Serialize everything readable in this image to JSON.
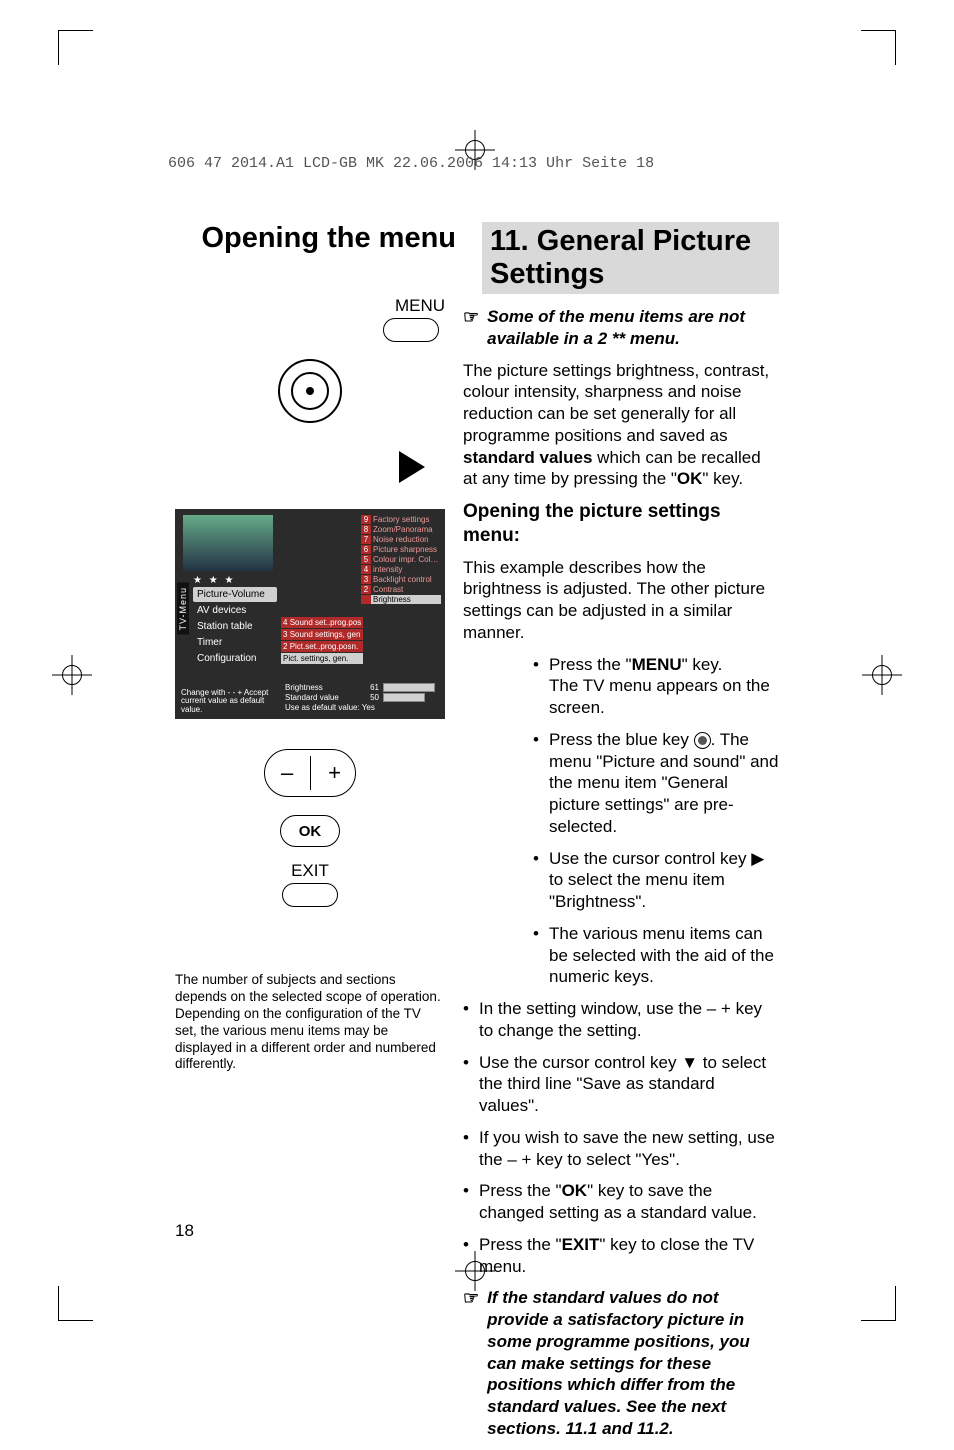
{
  "header_line": "606 47 2014.A1 LCD-GB MK  22.06.2006  14:13 Uhr  Seite 18",
  "title_left": "Opening the menu",
  "title_right": "11. General Picture Settings",
  "remote": {
    "menu_label": "MENU",
    "ok_label": "OK",
    "exit_label": "EXIT"
  },
  "osd": {
    "tab_vertical": "TV-Menu",
    "stars": "★  ★  ★",
    "side": [
      "Picture-Volume",
      "AV devices",
      "Station table",
      "Timer",
      "Configuration"
    ],
    "side_selected": 0,
    "mid": [
      "Sound set..prog.pos",
      "Sound settings, gen",
      "Pict.set..prog.posn.",
      "Pict. settings, gen."
    ],
    "mid_nums": [
      "4",
      "3",
      "2",
      ""
    ],
    "mid_selected": 3,
    "right": [
      {
        "n": "9",
        "t": "Factory settings"
      },
      {
        "n": "8",
        "t": "Zoom/Panorama"
      },
      {
        "n": "7",
        "t": "Noise reduction"
      },
      {
        "n": "6",
        "t": "Picture sharpness"
      },
      {
        "n": "5",
        "t": "Colour impr. Colour"
      },
      {
        "n": "4",
        "t": "intensity"
      },
      {
        "n": "3",
        "t": "Backlight control"
      },
      {
        "n": "2",
        "t": "Contrast"
      },
      {
        "n": "",
        "t": "Brightness"
      }
    ],
    "right_selected": 8,
    "hint": "Change with - - +\nAccept current\nvalue as default\nvalue.",
    "bars": {
      "brightness_label": "Brightness",
      "brightness_val": "61",
      "standard_label": "Standard value",
      "standard_val": "50",
      "default_label": "Use as default value: Yes"
    }
  },
  "footnote": "The number of subjects and sections depends on the selected scope of operation. Depending on the configuration of the TV set, the various menu items may be displayed in a different order and numbered differently.",
  "page_number": "18",
  "right_col": {
    "note1": "Some of the menu items are not available in a 2 ** menu.",
    "para1_a": "The picture settings brightness, contrast, colour intensity, sharpness and noise reduction can be set generally for all programme positions and saved as ",
    "para1_b": "standard values",
    "para1_c": " which can be recalled at any time by pressing the \"",
    "para1_d": "OK",
    "para1_e": "\" key.",
    "h2": "Opening the picture settings menu:",
    "intro": "This example describes how the brightness is adjusted. The other picture settings can be adjusted in a similar manner.",
    "b1a": "Press the \"",
    "b1b": "MENU",
    "b1c": "\" key.",
    "b1d": "The TV menu appears on the screen.",
    "b2a": "Press the blue key   ",
    "b2b": ". The menu \"Picture and sound\" and the menu item \"General picture settings\" are pre-selected.",
    "b3": "Use the cursor control key ▶ to select the menu item \"Brightness\".",
    "b4": "The various menu items can be selected with the aid of the numeric keys.",
    "b5": "In the setting window, use the – + key to change the setting.",
    "b6": "Use the cursor control key ▼ to select the third line \"Save as standard values\".",
    "b7": "If you wish to save the new setting, use the – + key to select \"Yes\".",
    "b8a": "Press the \"",
    "b8b": "OK",
    "b8c": "\" key to save the changed setting as a standard value.",
    "b9a": "Press the \"",
    "b9b": "EXIT",
    "b9c": "\" key to close the TV menu.",
    "note2": "If the standard values do not provide a satisfactory picture in some programme positions, you can make settings for these positions which differ from the standard values. See the next sections. 11.1 and 11.2."
  }
}
